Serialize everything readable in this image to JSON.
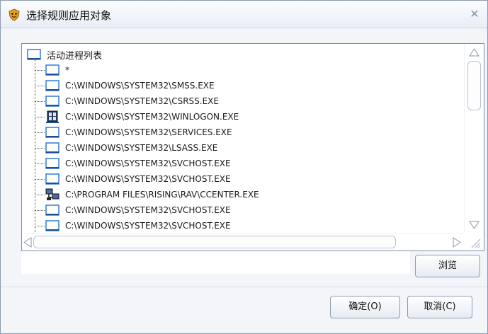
{
  "window": {
    "title": "选择规则应用对象"
  },
  "tree": {
    "root_label": "活动进程列表",
    "items": [
      {
        "label": "*",
        "icon": "window-icon"
      },
      {
        "label": "C:\\WINDOWS\\SYSTEM32\\SMSS.EXE",
        "icon": "window-icon"
      },
      {
        "label": "C:\\WINDOWS\\SYSTEM32\\CSRSS.EXE",
        "icon": "window-icon"
      },
      {
        "label": "C:\\WINDOWS\\SYSTEM32\\WINLOGON.EXE",
        "icon": "winlogon-icon"
      },
      {
        "label": "C:\\WINDOWS\\SYSTEM32\\SERVICES.EXE",
        "icon": "window-icon"
      },
      {
        "label": "C:\\WINDOWS\\SYSTEM32\\LSASS.EXE",
        "icon": "window-icon"
      },
      {
        "label": "C:\\WINDOWS\\SYSTEM32\\SVCHOST.EXE",
        "icon": "window-icon"
      },
      {
        "label": "C:\\WINDOWS\\SYSTEM32\\SVCHOST.EXE",
        "icon": "window-icon"
      },
      {
        "label": "C:\\PROGRAM FILES\\RISING\\RAV\\CCENTER.EXE",
        "icon": "network-computers-icon"
      },
      {
        "label": "C:\\WINDOWS\\SYSTEM32\\SVCHOST.EXE",
        "icon": "window-icon"
      },
      {
        "label": "C:\\WINDOWS\\SYSTEM32\\SVCHOST.EXE",
        "icon": "window-icon"
      }
    ]
  },
  "path_field": {
    "value": ""
  },
  "buttons": {
    "browse": "浏览",
    "ok": "确定(O)",
    "cancel": "取消(C)"
  },
  "colors": {
    "accent": "#2e7dd7",
    "border": "#7f8fa6"
  }
}
